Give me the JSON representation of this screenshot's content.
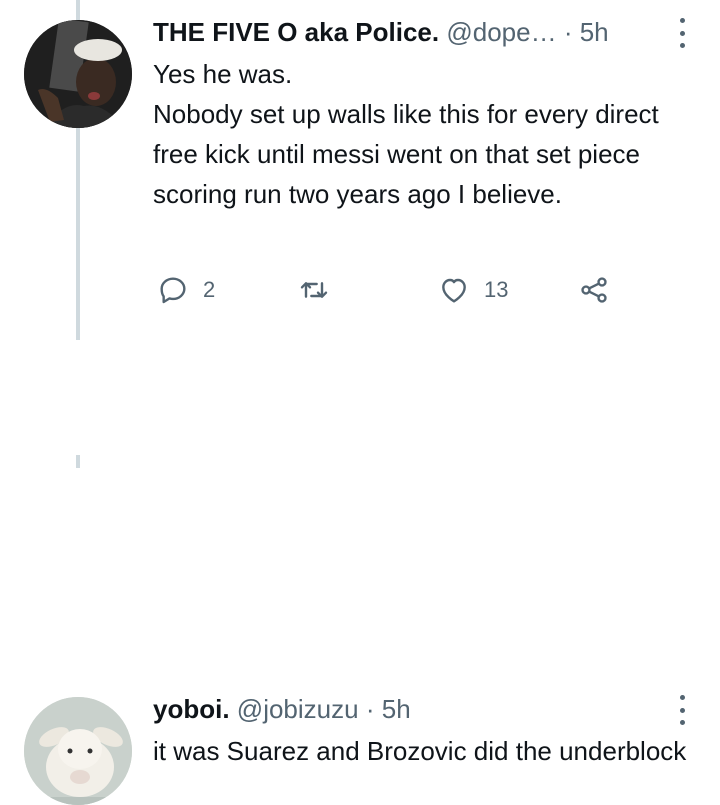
{
  "tweets": [
    {
      "display_name": "THE FIVE O aka Police.",
      "handle": "@dope…",
      "separator": "·",
      "time": "5h",
      "text": "Yes he was.\nNobody set up walls like this for every direct free kick until messi went on that set piece scoring run two years ago I believe.",
      "reply_count": "2",
      "retweet_count": "",
      "like_count": "13",
      "avatar_icon": "avatar-person-icon"
    },
    {
      "display_name": "yoboi.",
      "handle": "@jobizuzu",
      "separator": "·",
      "time": "5h",
      "text": "it was Suarez and Brozovic did the underblock",
      "avatar_icon": "avatar-goat-icon"
    }
  ],
  "colors": {
    "text_primary": "#0f1419",
    "text_secondary": "#536471",
    "thread_line": "#cfd9de",
    "background": "#ffffff"
  },
  "icons": [
    "reply-icon",
    "retweet-icon",
    "like-icon",
    "share-icon",
    "more-icon"
  ]
}
